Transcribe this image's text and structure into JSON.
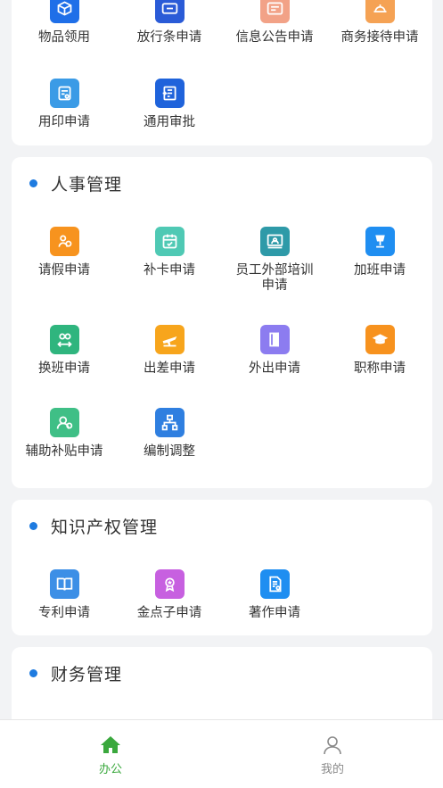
{
  "colors": {
    "accent_green": "#3aa83d",
    "section_dot": "#1e7be0",
    "tab_inactive": "#8a8a8a"
  },
  "section1": {
    "items": [
      {
        "label": "物品领用",
        "icon": "box-icon",
        "color": "#1f6fe8"
      },
      {
        "label": "放行条申请",
        "icon": "ticket-icon",
        "color": "#2a5bd7"
      },
      {
        "label": "信息公告申请",
        "icon": "announcement-icon",
        "color": "#f2a287"
      },
      {
        "label": "商务接待申请",
        "icon": "reception-icon",
        "color": "#f5a254"
      },
      {
        "label": "用印申请",
        "icon": "seal-icon",
        "color": "#3b9be6"
      },
      {
        "label": "通用审批",
        "icon": "approval-icon",
        "color": "#1f63db"
      }
    ]
  },
  "section2": {
    "title": "人事管理",
    "items": [
      {
        "label": "请假申请",
        "icon": "leave-icon",
        "color": "#f7931e"
      },
      {
        "label": "补卡申请",
        "icon": "calendar-check-icon",
        "color": "#4fc9b4"
      },
      {
        "label": "员工外部培训申请",
        "icon": "training-icon",
        "color": "#2e9aa8"
      },
      {
        "label": "加班申请",
        "icon": "lamp-icon",
        "color": "#1f8ef1"
      },
      {
        "label": "换班申请",
        "icon": "shift-swap-icon",
        "color": "#2fb57e"
      },
      {
        "label": "出差申请",
        "icon": "plane-icon",
        "color": "#f7a51c"
      },
      {
        "label": "外出申请",
        "icon": "door-icon",
        "color": "#8c7cf0"
      },
      {
        "label": "职称申请",
        "icon": "graduation-cap-icon",
        "color": "#f7921e"
      },
      {
        "label": "辅助补贴申请",
        "icon": "subsidy-icon",
        "color": "#3fbf86"
      },
      {
        "label": "编制调整",
        "icon": "org-chart-icon",
        "color": "#2f7fe0"
      }
    ]
  },
  "section3": {
    "title": "知识产权管理",
    "items": [
      {
        "label": "专利申请",
        "icon": "book-icon",
        "color": "#3d8fe6"
      },
      {
        "label": "金点子申请",
        "icon": "idea-icon",
        "color": "#c760e0"
      },
      {
        "label": "著作申请",
        "icon": "document-icon",
        "color": "#1f8ef1"
      }
    ]
  },
  "section4": {
    "title": "财务管理"
  },
  "tabbar": {
    "office_label": "办公",
    "mine_label": "我的"
  }
}
